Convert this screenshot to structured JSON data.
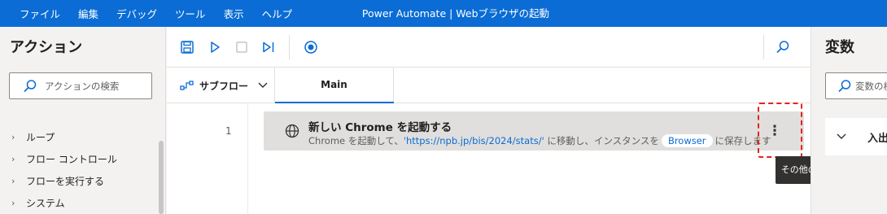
{
  "menu": [
    "ファイル",
    "編集",
    "デバッグ",
    "ツール",
    "表示",
    "ヘルプ"
  ],
  "window_title": "Power Automate | Webブラウザの起動",
  "actions_panel": {
    "title": "アクション",
    "search_placeholder": "アクションの検索",
    "tree": [
      "ループ",
      "フロー コントロール",
      "フローを実行する",
      "システム"
    ]
  },
  "toolbar": {
    "save_icon": "save-icon",
    "run_icon": "play-icon",
    "stop_icon": "stop-icon",
    "next_icon": "step-icon",
    "record_icon": "record-icon",
    "search_icon": "search-icon"
  },
  "tabs": {
    "subflow_label": "サブフロー",
    "main_label": "Main"
  },
  "flow": {
    "line_number": "1",
    "action_title": "新しい Chrome を起動する",
    "desc_prefix": "Chrome を起動して、",
    "desc_url": "'https://npb.jp/bis/2024/stats/'",
    "desc_middle": " に移動し、インスタンスを",
    "desc_variable": "Browser",
    "desc_suffix": "に保存します",
    "more_label": "⋮",
    "tooltip": "その他のアクション"
  },
  "variables_panel": {
    "title": "変数",
    "search_placeholder": "変数の検",
    "section_label": "入出"
  },
  "colors": {
    "accent": "#0a6cd4",
    "titlebar": "#0a6cd4",
    "highlight": "#e3241c"
  }
}
